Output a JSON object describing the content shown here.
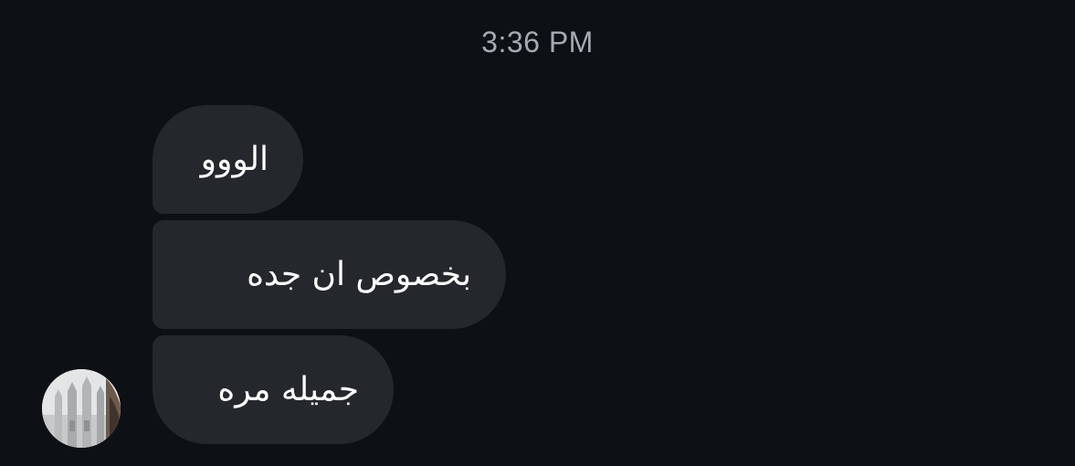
{
  "conversation": {
    "timestamp": "3:36 PM",
    "messages": [
      {
        "text": "الووو"
      },
      {
        "text": "بخصوص ان جده"
      },
      {
        "text": "جميله مره"
      }
    ],
    "sender_avatar": {
      "icon": "building-photo-avatar"
    }
  },
  "colors": {
    "background": "#0d1014",
    "bubble": "#24272c",
    "timestamp": "#a6aab0",
    "message_text": "#ffffff"
  }
}
